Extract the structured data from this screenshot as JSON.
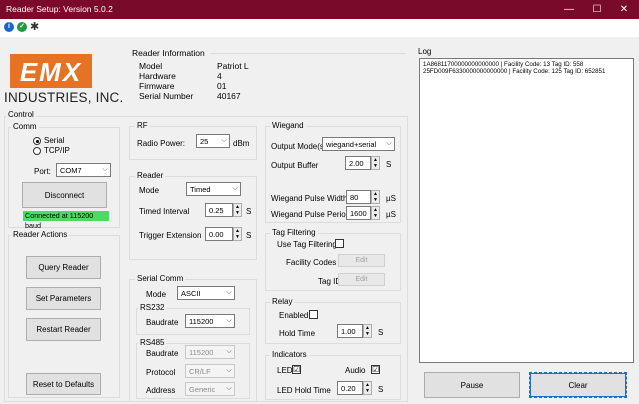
{
  "window": {
    "title": "Reader Setup: Version 5.0.2",
    "controls": {
      "minimize": "—",
      "maximize": "☐",
      "close": "✕"
    }
  },
  "icons": [
    "info-icon",
    "check-icon",
    "settings-icon"
  ],
  "logo": {
    "text": "EMX",
    "company": "INDUSTRIES, INC.",
    "color": "#e57323"
  },
  "reader_info": {
    "title": "Reader Information",
    "rows": [
      {
        "label": "Model",
        "value": "Patriot L"
      },
      {
        "label": "Hardware",
        "value": "4"
      },
      {
        "label": "Firmware",
        "value": "01"
      },
      {
        "label": "Serial Number",
        "value": "40167"
      }
    ]
  },
  "control": {
    "title": "Control"
  },
  "comm": {
    "title": "Comm",
    "serial_label": "Serial",
    "tcpip_label": "TCP/IP",
    "port_label": "Port:",
    "port_value": "COM7",
    "disconnect_label": "Disconnect",
    "status": "Connected at 115200 baud",
    "status_color": "#4cd964"
  },
  "reader_actions": {
    "title": "Reader Actions",
    "query": "Query Reader",
    "set_params": "Set Parameters",
    "restart": "Restart Reader",
    "reset": "Reset to Defaults"
  },
  "rf": {
    "title": "RF",
    "power_label": "Radio Power:",
    "power_value": "25",
    "unit": "dBm"
  },
  "reader": {
    "title": "Reader",
    "mode_label": "Mode",
    "mode_value": "Timed",
    "interval_label": "Timed Interval",
    "interval_value": "0.25",
    "interval_unit": "S",
    "trigger_label": "Trigger Extension",
    "trigger_value": "0.00",
    "trigger_unit": "S"
  },
  "serial_comm": {
    "title": "Serial Comm",
    "mode_label": "Mode",
    "mode_value": "ASCII",
    "rs232": "RS232",
    "baud_label": "Baudrate",
    "baud_value": "115200",
    "rs485": "RS485",
    "rs485_baud_label": "Baudrate",
    "rs485_baud_value": "115200",
    "protocol_label": "Protocol",
    "protocol_value": "CR/LF",
    "address_label": "Address",
    "address_value": "Generic"
  },
  "wiegand": {
    "title": "Wiegand",
    "output_label": "Output Mode(s)",
    "output_value": "wiegand+serial",
    "buffer_label": "Output Buffer",
    "buffer_value": "2.00",
    "buffer_unit": "S",
    "width_label": "Wiegand Pulse Width",
    "width_value": "80",
    "width_unit": "µS",
    "period_label": "Wiegand Pulse Period",
    "period_value": "1600",
    "period_unit": "µS"
  },
  "tag_filtering": {
    "title": "Tag Filtering",
    "use_label": "Use Tag Filtering",
    "facility_label": "Facility Codes",
    "facility_btn": "Edit",
    "tagids_label": "Tag IDs",
    "tagids_btn": "Edit"
  },
  "relay": {
    "title": "Relay",
    "enabled_label": "Enabled",
    "hold_label": "Hold Time",
    "hold_value": "1.00",
    "hold_unit": "S"
  },
  "indicators": {
    "title": "Indicators",
    "led_label": "LED",
    "led_checked": "☑",
    "audio_label": "Audio",
    "audio_checked": "☑",
    "hold_label": "LED Hold Time",
    "hold_value": "0.20",
    "hold_unit": "S"
  },
  "log": {
    "title": "Log",
    "lines": [
      "1A86811700000000000000 | Facility Code: 13 Tag ID: 558",
      "25FD009F6330000000000000 | Facility Code: 125 Tag ID: 652851"
    ]
  },
  "log_buttons": {
    "pause": "Pause",
    "clear": "Clear"
  }
}
